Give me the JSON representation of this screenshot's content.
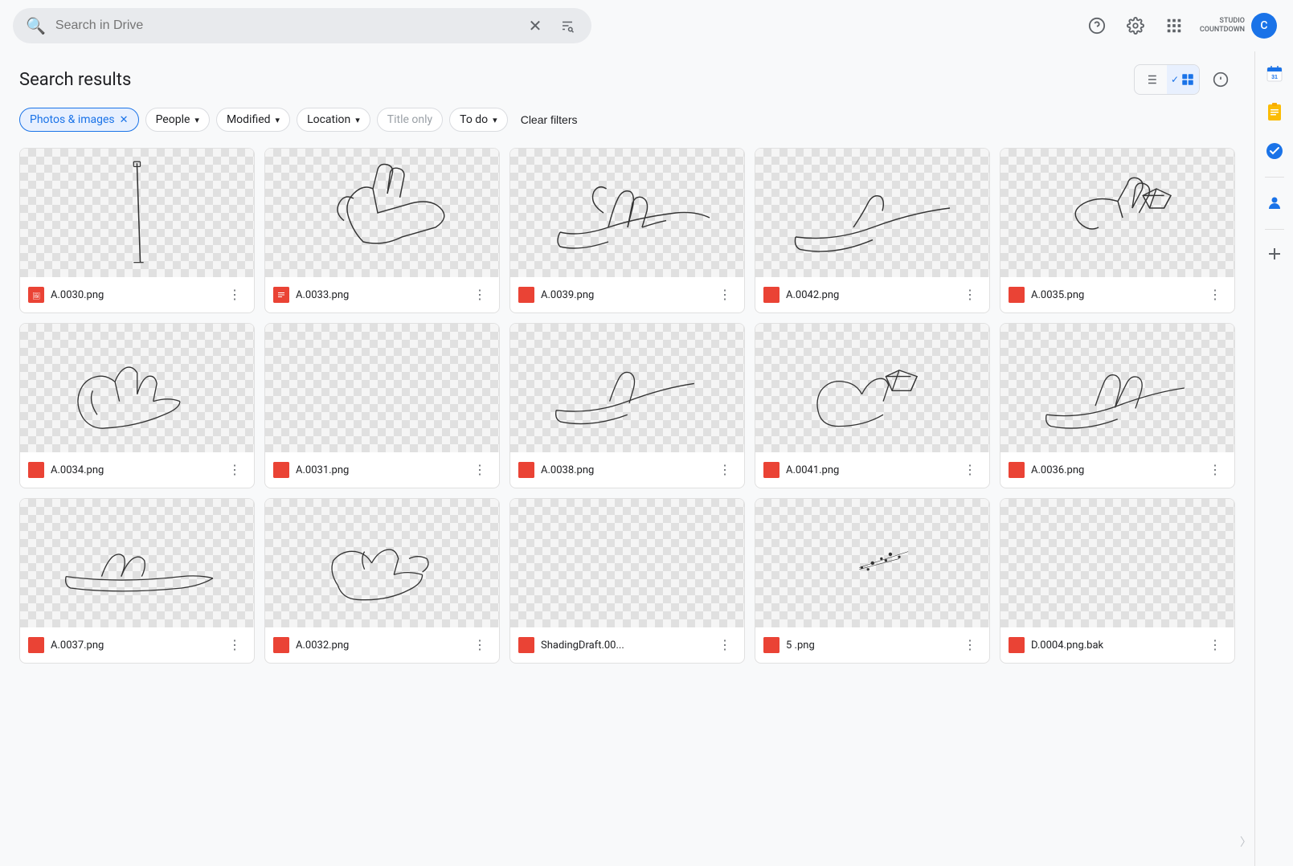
{
  "topbar": {
    "search_placeholder": "Search in Drive",
    "help_icon": "?",
    "settings_icon": "⚙",
    "apps_icon": "⋮⋮⋮",
    "account_logo_line1": "STUDIO",
    "account_logo_line2": "COUNTDOWN",
    "avatar_letter": "C"
  },
  "page": {
    "title": "Search results"
  },
  "view_controls": {
    "list_icon": "☰",
    "grid_icon": "⊞",
    "info_icon": "ⓘ"
  },
  "filters": [
    {
      "id": "photos-images",
      "label": "Photos & images",
      "active": true,
      "closable": true
    },
    {
      "id": "people",
      "label": "People",
      "active": false,
      "closable": false,
      "has_arrow": true
    },
    {
      "id": "modified",
      "label": "Modified",
      "active": false,
      "closable": false,
      "has_arrow": true
    },
    {
      "id": "location",
      "label": "Location",
      "active": false,
      "closable": false,
      "has_arrow": true
    },
    {
      "id": "title-only",
      "label": "Title only",
      "active": false,
      "closable": false,
      "disabled": true
    },
    {
      "id": "to-do",
      "label": "To do",
      "active": false,
      "closable": false,
      "has_arrow": true
    }
  ],
  "clear_filters_label": "Clear filters",
  "files": [
    {
      "id": 1,
      "name": "A.0030.png",
      "row": 0
    },
    {
      "id": 2,
      "name": "A.0033.png",
      "row": 0
    },
    {
      "id": 3,
      "name": "A.0039.png",
      "row": 0
    },
    {
      "id": 4,
      "name": "A.0042.png",
      "row": 0
    },
    {
      "id": 5,
      "name": "A.0035.png",
      "row": 0
    },
    {
      "id": 6,
      "name": "A.0034.png",
      "row": 1
    },
    {
      "id": 7,
      "name": "A.0031.png",
      "row": 1
    },
    {
      "id": 8,
      "name": "A.0038.png",
      "row": 1
    },
    {
      "id": 9,
      "name": "A.0041.png",
      "row": 1
    },
    {
      "id": 10,
      "name": "A.0036.png",
      "row": 1
    },
    {
      "id": 11,
      "name": "A.0037.png",
      "row": 2
    },
    {
      "id": 12,
      "name": "A.0032.png",
      "row": 2
    },
    {
      "id": 13,
      "name": "ShadingDraft.00...",
      "row": 2
    },
    {
      "id": 14,
      "name": "5 .png",
      "row": 2
    },
    {
      "id": 15,
      "name": "D.0004.png.bak",
      "row": 2
    }
  ],
  "right_sidebar": {
    "calendar_icon": "📅",
    "note_icon": "📒",
    "tasks_icon": "✓",
    "contacts_icon": "👤",
    "add_icon": "+"
  }
}
